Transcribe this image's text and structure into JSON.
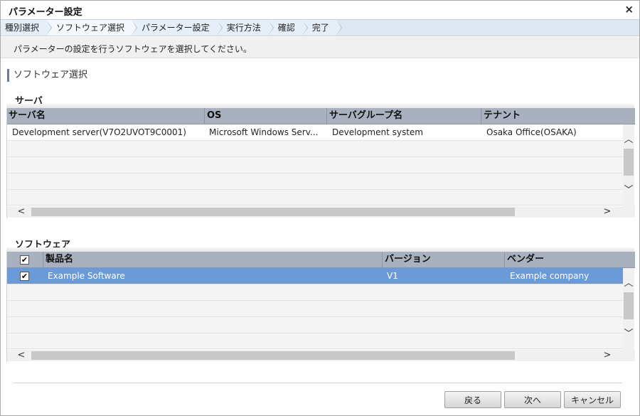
{
  "window": {
    "title": "パラメーター設定",
    "close_glyph": "×"
  },
  "steps": [
    "種別選択",
    "ソフトウェア選択",
    "パラメーター設定",
    "実行方法",
    "確認",
    "完了"
  ],
  "instruction": "パラメーターの設定を行うソフトウェアを選択してください。",
  "section_title": "ソフトウェア選択",
  "server_group": {
    "label": "サーバ",
    "columns": [
      "サーバ名",
      "OS",
      "サーバグループ名",
      "テナント"
    ],
    "rows": [
      [
        "Development server(V7O2UVOT9C0001)",
        "Microsoft Windows Serv...",
        "Development system",
        "Osaka Office(OSAKA)"
      ]
    ]
  },
  "software_group": {
    "label": "ソフトウェア",
    "columns": [
      "製品名",
      "バージョン",
      "ベンダー"
    ],
    "header_checked": true,
    "rows": [
      {
        "checked": true,
        "cells": [
          "Example Software",
          "V1",
          "Example company"
        ]
      }
    ]
  },
  "buttons": {
    "back": "戻る",
    "next": "次へ",
    "cancel": "キャンセル"
  },
  "icons": {
    "check": "✔",
    "scroll_up": "chevron-up-icon",
    "scroll_down": "chevron-down-icon",
    "scroll_left": "chevron-left-icon",
    "scroll_right": "chevron-right-icon"
  },
  "colors": {
    "header_bg": "#a9b1bf",
    "selected_row": "#6a9ad8",
    "steps_bg": "#dde7f2"
  }
}
